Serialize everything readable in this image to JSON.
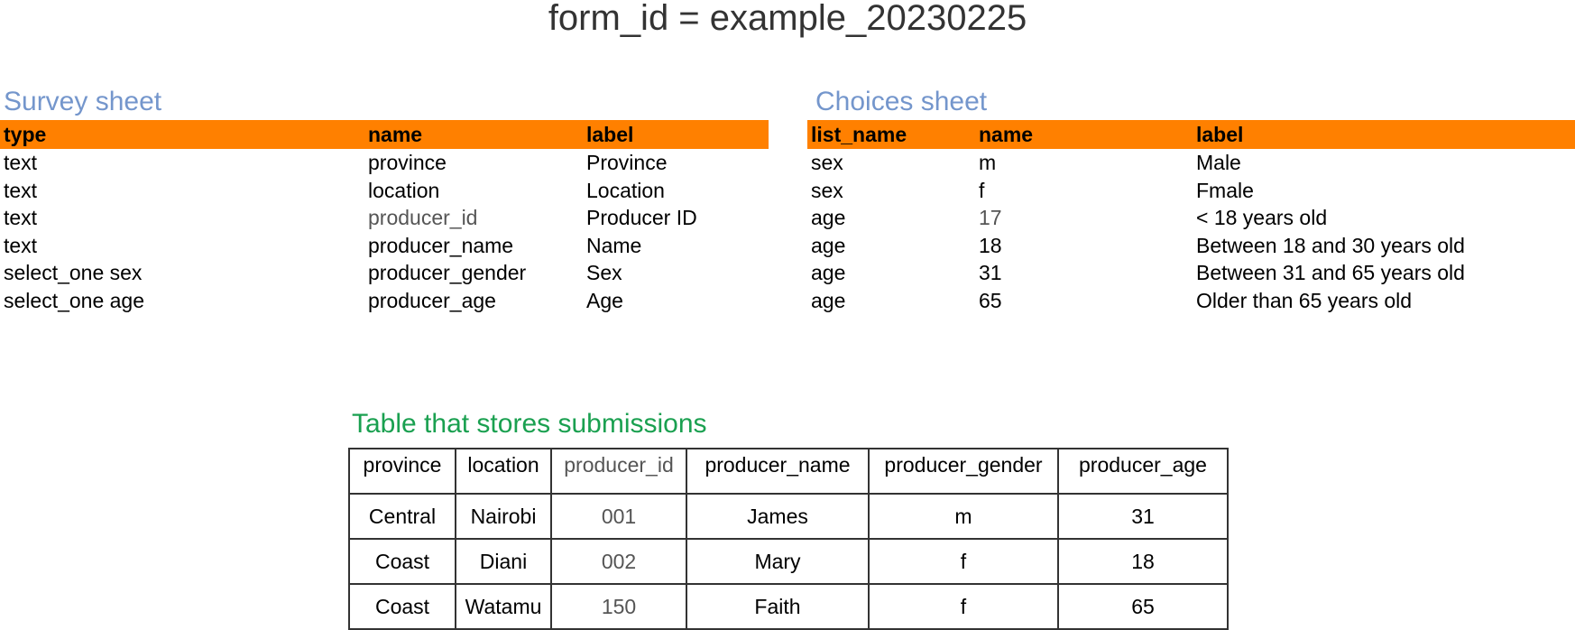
{
  "title": "form_id = example_20230225",
  "survey": {
    "heading": "Survey sheet",
    "columns": [
      "type",
      "name",
      "label"
    ],
    "rows": [
      [
        "text",
        "province",
        "Province"
      ],
      [
        "text",
        "location",
        "Location"
      ],
      [
        "text",
        "producer_id",
        "Producer ID"
      ],
      [
        "text",
        "producer_name",
        "Name"
      ],
      [
        "select_one sex",
        "producer_gender",
        "Sex"
      ],
      [
        "select_one age",
        "producer_age",
        "Age"
      ]
    ]
  },
  "choices": {
    "heading": "Choices sheet",
    "columns": [
      "list_name",
      "name",
      "label"
    ],
    "rows": [
      [
        "sex",
        "m",
        "Male"
      ],
      [
        "sex",
        "f",
        "Fmale"
      ],
      [
        "age",
        "17",
        "< 18 years old"
      ],
      [
        "age",
        "18",
        "Between 18 and 30 years old"
      ],
      [
        "age",
        "31",
        "Between 31 and 65 years old"
      ],
      [
        "age",
        "65",
        "Older than 65 years old"
      ]
    ]
  },
  "submissions": {
    "heading": "Table that stores submissions",
    "columns": [
      "province",
      "location",
      "producer_id",
      "producer_name",
      "producer_gender",
      "producer_age"
    ],
    "rows": [
      [
        "Central",
        "Nairobi",
        "001",
        "James",
        "m",
        "31"
      ],
      [
        "Coast",
        "Diani",
        "002",
        "Mary",
        "f",
        "18"
      ],
      [
        "Coast",
        "Watamu",
        "150",
        "Faith",
        "f",
        "65"
      ]
    ]
  },
  "colors": {
    "header_fill": "#ff8000",
    "sheet_heading": "#7496cc",
    "submissions_heading": "#1aa050",
    "highlight_text": "#555555"
  }
}
